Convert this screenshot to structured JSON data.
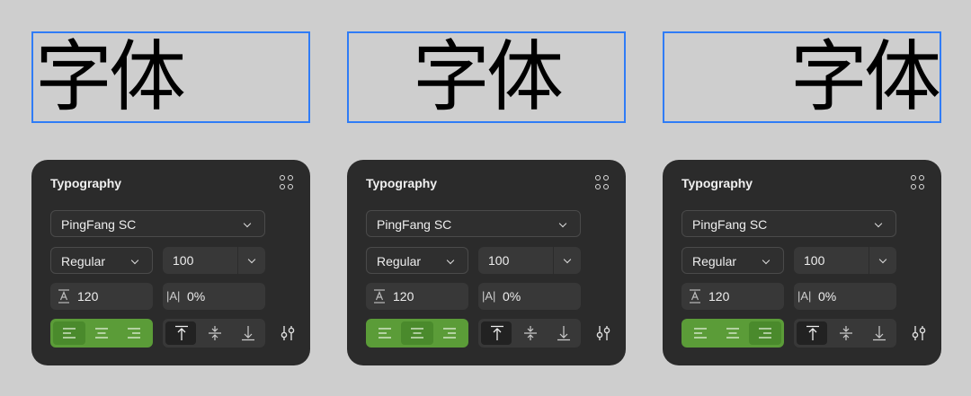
{
  "sample_text": "字体",
  "colors": {
    "background": "#cecece",
    "selection_border": "#2f7cf6",
    "panel": "#2b2b2b",
    "accent_green": "#5b9c38"
  },
  "panels": [
    {
      "text_align": "left",
      "title": "Typography",
      "font_family": "PingFang SC",
      "font_weight": "Regular",
      "font_size": "100",
      "line_height": "120",
      "letter_spacing": "0%",
      "horizontal_align": "left",
      "vertical_align": "top"
    },
    {
      "text_align": "center",
      "title": "Typography",
      "font_family": "PingFang SC",
      "font_weight": "Regular",
      "font_size": "100",
      "line_height": "120",
      "letter_spacing": "0%",
      "horizontal_align": "center",
      "vertical_align": "top"
    },
    {
      "text_align": "right",
      "title": "Typography",
      "font_family": "PingFang SC",
      "font_weight": "Regular",
      "font_size": "100",
      "line_height": "120",
      "letter_spacing": "0%",
      "horizontal_align": "right",
      "vertical_align": "top"
    }
  ],
  "icons": {
    "more": "more-dots-icon",
    "align_left": "align-left-icon",
    "align_center": "align-center-icon",
    "align_right": "align-right-icon",
    "valign_top": "align-top-icon",
    "valign_middle": "align-middle-icon",
    "valign_bottom": "align-bottom-icon",
    "settings": "sliders-icon",
    "line_height": "line-height-icon",
    "letter_spacing": "letter-spacing-icon"
  }
}
